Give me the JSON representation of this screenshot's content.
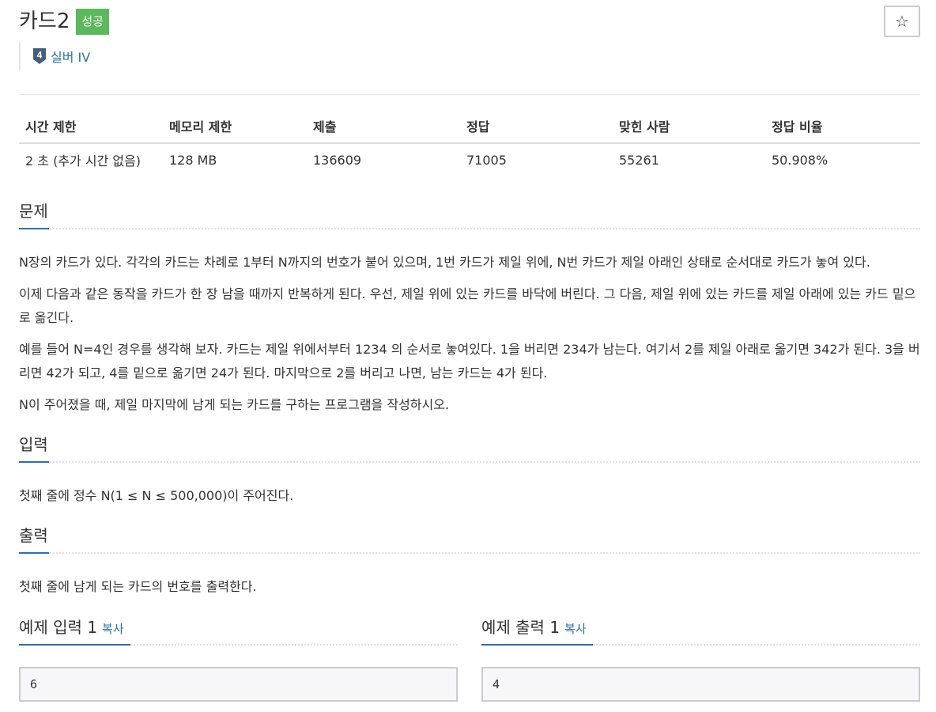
{
  "problem": {
    "title": "카드2",
    "result_badge": "성공",
    "tier_label": "실버 IV",
    "tier_number": "4",
    "star_glyph": "☆"
  },
  "info_table": {
    "headers": [
      "시간 제한",
      "메모리 제한",
      "제출",
      "정답",
      "맞힌 사람",
      "정답 비율"
    ],
    "values": [
      "2 초 (추가 시간 없음)",
      "128 MB",
      "136609",
      "71005",
      "55261",
      "50.908%"
    ]
  },
  "description": {
    "title": "문제",
    "paragraphs": [
      "N장의 카드가 있다. 각각의 카드는 차례로 1부터 N까지의 번호가 붙어 있으며, 1번 카드가 제일 위에, N번 카드가 제일 아래인 상태로 순서대로 카드가 놓여 있다.",
      "이제 다음과 같은 동작을 카드가 한 장 남을 때까지 반복하게 된다. 우선, 제일 위에 있는 카드를 바닥에 버린다. 그 다음, 제일 위에 있는 카드를 제일 아래에 있는 카드 밑으로 옮긴다.",
      "예를 들어 N=4인 경우를 생각해 보자. 카드는 제일 위에서부터 1234 의 순서로 놓여있다. 1을 버리면 234가 남는다. 여기서 2를 제일 아래로 옮기면 342가 된다. 3을 버리면 42가 되고, 4를 밑으로 옮기면 24가 된다. 마지막으로 2를 버리고 나면, 남는 카드는 4가 된다.",
      "N이 주어졌을 때, 제일 마지막에 남게 되는 카드를 구하는 프로그램을 작성하시오."
    ]
  },
  "input": {
    "title": "입력",
    "text": "첫째 줄에 정수 N(1 ≤ N ≤ 500,000)이 주어진다."
  },
  "output": {
    "title": "출력",
    "text": "첫째 줄에 남게 되는 카드의 번호를 출력한다."
  },
  "samples": {
    "input_title": "예제 입력 1",
    "output_title": "예제 출력 1",
    "copy_label": "복사",
    "input_value": "6",
    "output_value": "4"
  },
  "colors": {
    "accent": "#2f6fa8",
    "success": "#5cb85c"
  }
}
